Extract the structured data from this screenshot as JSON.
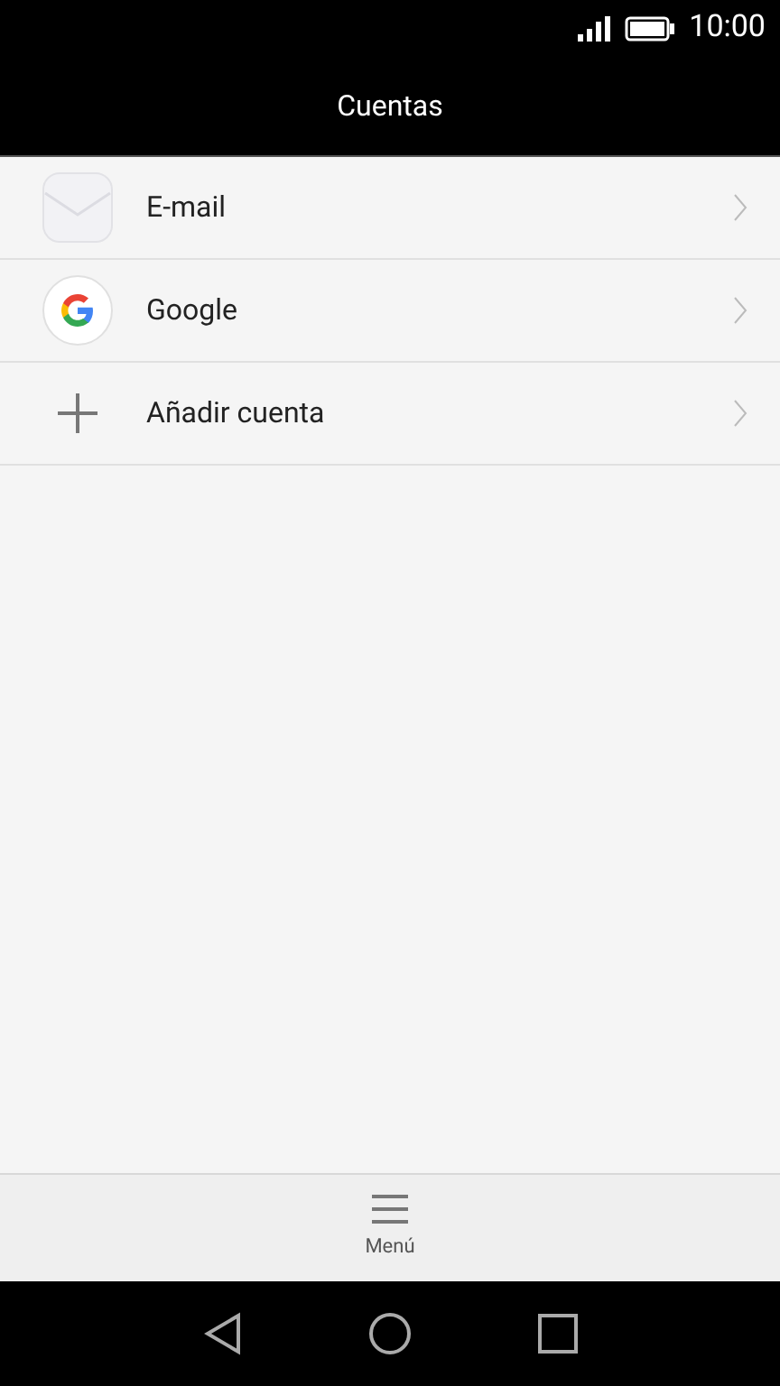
{
  "status_bar": {
    "time": "10:00"
  },
  "title": "Cuentas",
  "accounts": [
    {
      "kind": "email",
      "label": "E-mail"
    },
    {
      "kind": "google",
      "label": "Google"
    },
    {
      "kind": "add",
      "label": "Añadir cuenta"
    }
  ],
  "bottom_bar": {
    "label": "Menú"
  }
}
